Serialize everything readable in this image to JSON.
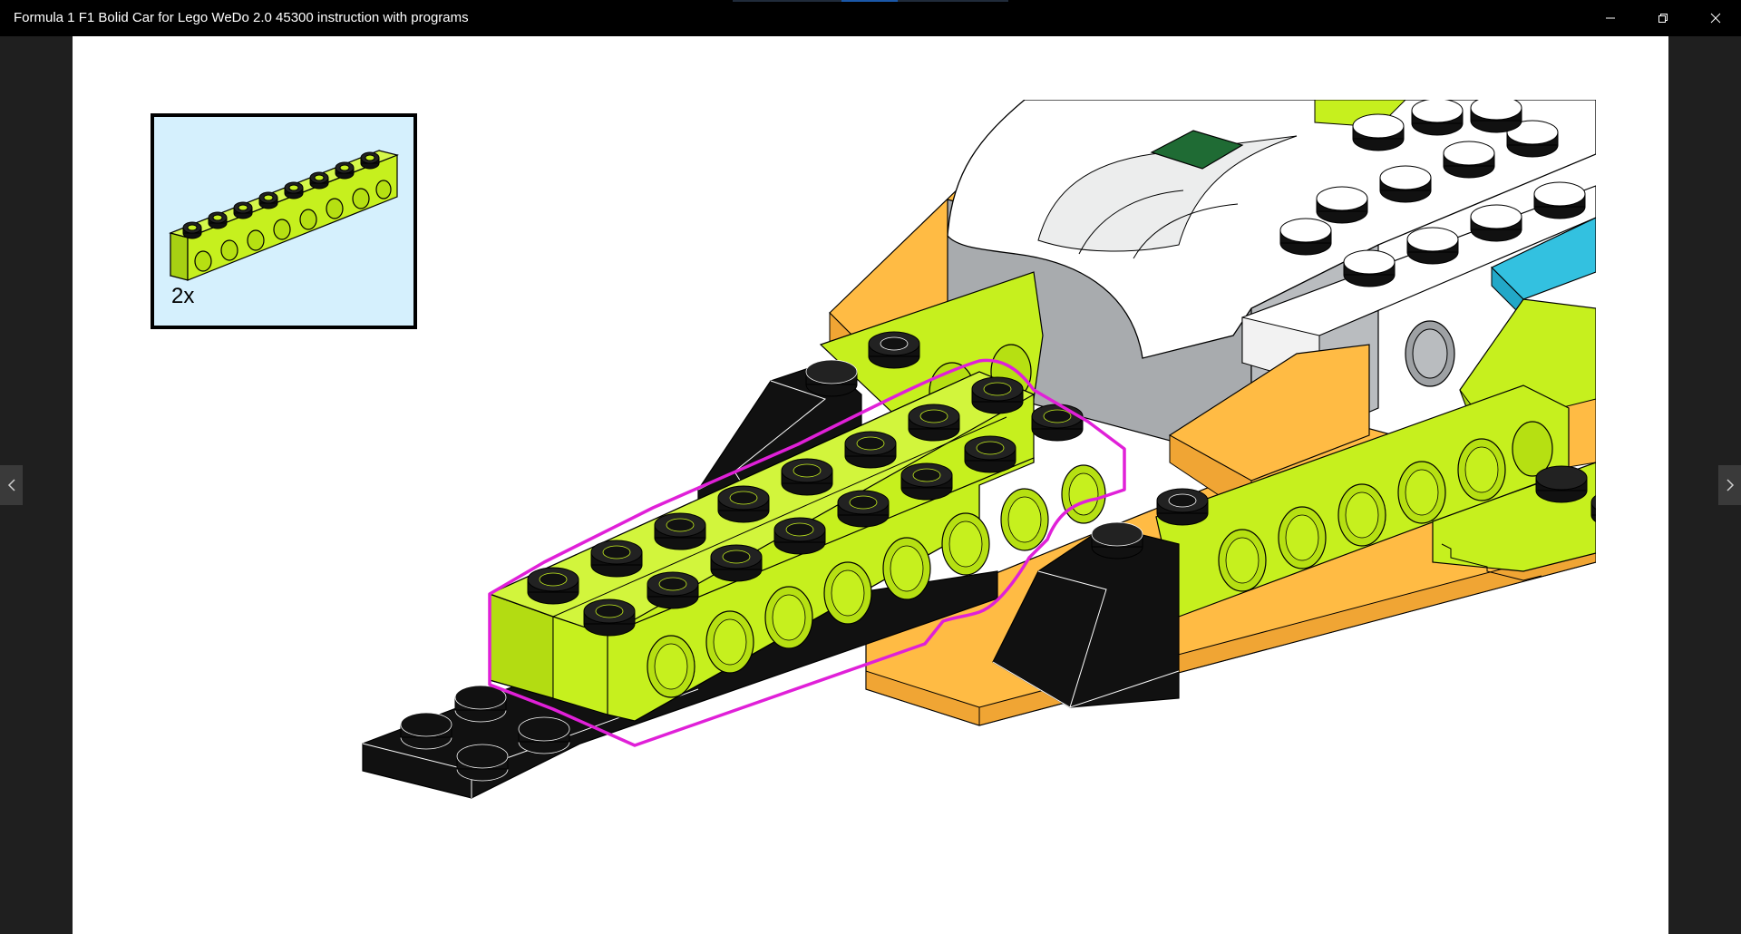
{
  "window": {
    "title": "Formula 1 F1 Bolid Car for Lego WeDo 2.0 45300 instruction with programs",
    "controls": {
      "minimize_icon": "minimize-icon",
      "restore_icon": "restore-icon",
      "close_icon": "close-icon"
    }
  },
  "navigation": {
    "previous_icon": "chevron-left-icon",
    "next_icon": "chevron-right-icon"
  },
  "instruction_step": {
    "part_callout": {
      "part": "lime technic brick 1x8 with holes",
      "quantity": "2x"
    },
    "colors": {
      "lime": "#c6f01e",
      "black": "#111111",
      "orange": "#ffbb44",
      "white": "#ffffff",
      "gray": "#a8abae",
      "green": "#1f6b34",
      "cyan": "#33c1e0",
      "highlight": "#e020d8"
    }
  }
}
